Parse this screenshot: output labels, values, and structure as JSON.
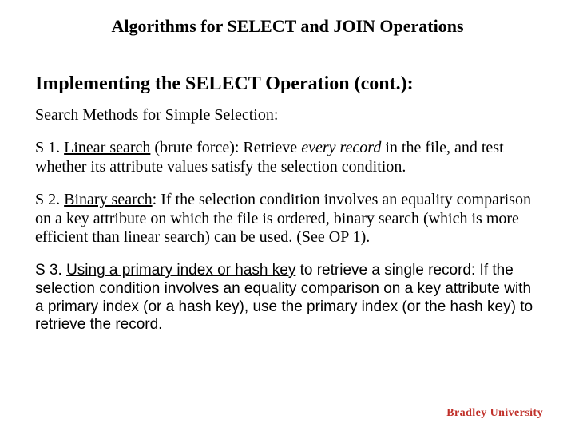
{
  "title": "Algorithms for SELECT and JOIN Operations",
  "subtitle": "Implementing the SELECT Operation (cont.):",
  "section_label": "Search Methods for Simple Selection:",
  "s1": {
    "prefix": "S 1. ",
    "method": "Linear search",
    "after_method": " (brute force): Retrieve ",
    "italic": "every record",
    "rest": " in the file, and test whether its attribute values satisfy the selection condition."
  },
  "s2": {
    "prefix": "S 2. ",
    "method": "Binary search",
    "rest": ": If the selection condition involves an equality comparison on a key attribute on which the file is ordered, binary search (which is more efficient than linear search) can be used. (See OP 1)."
  },
  "s3": {
    "prefix": "S 3. ",
    "method": "Using a primary index or hash key",
    "rest": " to retrieve a single record: If the selection condition involves an equality comparison on a key attribute with a primary index (or a hash key), use the primary index (or the hash key) to retrieve the record."
  },
  "logo": "Bradley University"
}
